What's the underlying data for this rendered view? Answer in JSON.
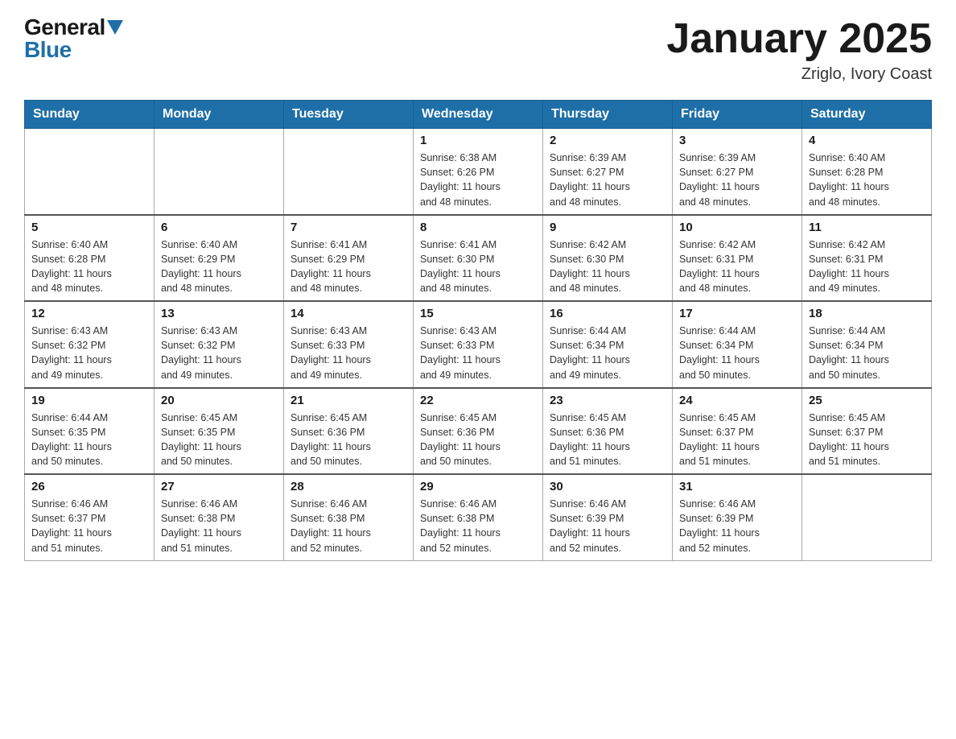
{
  "header": {
    "logo_top": "General",
    "logo_bottom": "Blue",
    "month_title": "January 2025",
    "location": "Zriglo, Ivory Coast"
  },
  "days_of_week": [
    "Sunday",
    "Monday",
    "Tuesday",
    "Wednesday",
    "Thursday",
    "Friday",
    "Saturday"
  ],
  "weeks": [
    [
      {
        "num": "",
        "info": ""
      },
      {
        "num": "",
        "info": ""
      },
      {
        "num": "",
        "info": ""
      },
      {
        "num": "1",
        "info": "Sunrise: 6:38 AM\nSunset: 6:26 PM\nDaylight: 11 hours\nand 48 minutes."
      },
      {
        "num": "2",
        "info": "Sunrise: 6:39 AM\nSunset: 6:27 PM\nDaylight: 11 hours\nand 48 minutes."
      },
      {
        "num": "3",
        "info": "Sunrise: 6:39 AM\nSunset: 6:27 PM\nDaylight: 11 hours\nand 48 minutes."
      },
      {
        "num": "4",
        "info": "Sunrise: 6:40 AM\nSunset: 6:28 PM\nDaylight: 11 hours\nand 48 minutes."
      }
    ],
    [
      {
        "num": "5",
        "info": "Sunrise: 6:40 AM\nSunset: 6:28 PM\nDaylight: 11 hours\nand 48 minutes."
      },
      {
        "num": "6",
        "info": "Sunrise: 6:40 AM\nSunset: 6:29 PM\nDaylight: 11 hours\nand 48 minutes."
      },
      {
        "num": "7",
        "info": "Sunrise: 6:41 AM\nSunset: 6:29 PM\nDaylight: 11 hours\nand 48 minutes."
      },
      {
        "num": "8",
        "info": "Sunrise: 6:41 AM\nSunset: 6:30 PM\nDaylight: 11 hours\nand 48 minutes."
      },
      {
        "num": "9",
        "info": "Sunrise: 6:42 AM\nSunset: 6:30 PM\nDaylight: 11 hours\nand 48 minutes."
      },
      {
        "num": "10",
        "info": "Sunrise: 6:42 AM\nSunset: 6:31 PM\nDaylight: 11 hours\nand 48 minutes."
      },
      {
        "num": "11",
        "info": "Sunrise: 6:42 AM\nSunset: 6:31 PM\nDaylight: 11 hours\nand 49 minutes."
      }
    ],
    [
      {
        "num": "12",
        "info": "Sunrise: 6:43 AM\nSunset: 6:32 PM\nDaylight: 11 hours\nand 49 minutes."
      },
      {
        "num": "13",
        "info": "Sunrise: 6:43 AM\nSunset: 6:32 PM\nDaylight: 11 hours\nand 49 minutes."
      },
      {
        "num": "14",
        "info": "Sunrise: 6:43 AM\nSunset: 6:33 PM\nDaylight: 11 hours\nand 49 minutes."
      },
      {
        "num": "15",
        "info": "Sunrise: 6:43 AM\nSunset: 6:33 PM\nDaylight: 11 hours\nand 49 minutes."
      },
      {
        "num": "16",
        "info": "Sunrise: 6:44 AM\nSunset: 6:34 PM\nDaylight: 11 hours\nand 49 minutes."
      },
      {
        "num": "17",
        "info": "Sunrise: 6:44 AM\nSunset: 6:34 PM\nDaylight: 11 hours\nand 50 minutes."
      },
      {
        "num": "18",
        "info": "Sunrise: 6:44 AM\nSunset: 6:34 PM\nDaylight: 11 hours\nand 50 minutes."
      }
    ],
    [
      {
        "num": "19",
        "info": "Sunrise: 6:44 AM\nSunset: 6:35 PM\nDaylight: 11 hours\nand 50 minutes."
      },
      {
        "num": "20",
        "info": "Sunrise: 6:45 AM\nSunset: 6:35 PM\nDaylight: 11 hours\nand 50 minutes."
      },
      {
        "num": "21",
        "info": "Sunrise: 6:45 AM\nSunset: 6:36 PM\nDaylight: 11 hours\nand 50 minutes."
      },
      {
        "num": "22",
        "info": "Sunrise: 6:45 AM\nSunset: 6:36 PM\nDaylight: 11 hours\nand 50 minutes."
      },
      {
        "num": "23",
        "info": "Sunrise: 6:45 AM\nSunset: 6:36 PM\nDaylight: 11 hours\nand 51 minutes."
      },
      {
        "num": "24",
        "info": "Sunrise: 6:45 AM\nSunset: 6:37 PM\nDaylight: 11 hours\nand 51 minutes."
      },
      {
        "num": "25",
        "info": "Sunrise: 6:45 AM\nSunset: 6:37 PM\nDaylight: 11 hours\nand 51 minutes."
      }
    ],
    [
      {
        "num": "26",
        "info": "Sunrise: 6:46 AM\nSunset: 6:37 PM\nDaylight: 11 hours\nand 51 minutes."
      },
      {
        "num": "27",
        "info": "Sunrise: 6:46 AM\nSunset: 6:38 PM\nDaylight: 11 hours\nand 51 minutes."
      },
      {
        "num": "28",
        "info": "Sunrise: 6:46 AM\nSunset: 6:38 PM\nDaylight: 11 hours\nand 52 minutes."
      },
      {
        "num": "29",
        "info": "Sunrise: 6:46 AM\nSunset: 6:38 PM\nDaylight: 11 hours\nand 52 minutes."
      },
      {
        "num": "30",
        "info": "Sunrise: 6:46 AM\nSunset: 6:39 PM\nDaylight: 11 hours\nand 52 minutes."
      },
      {
        "num": "31",
        "info": "Sunrise: 6:46 AM\nSunset: 6:39 PM\nDaylight: 11 hours\nand 52 minutes."
      },
      {
        "num": "",
        "info": ""
      }
    ]
  ]
}
